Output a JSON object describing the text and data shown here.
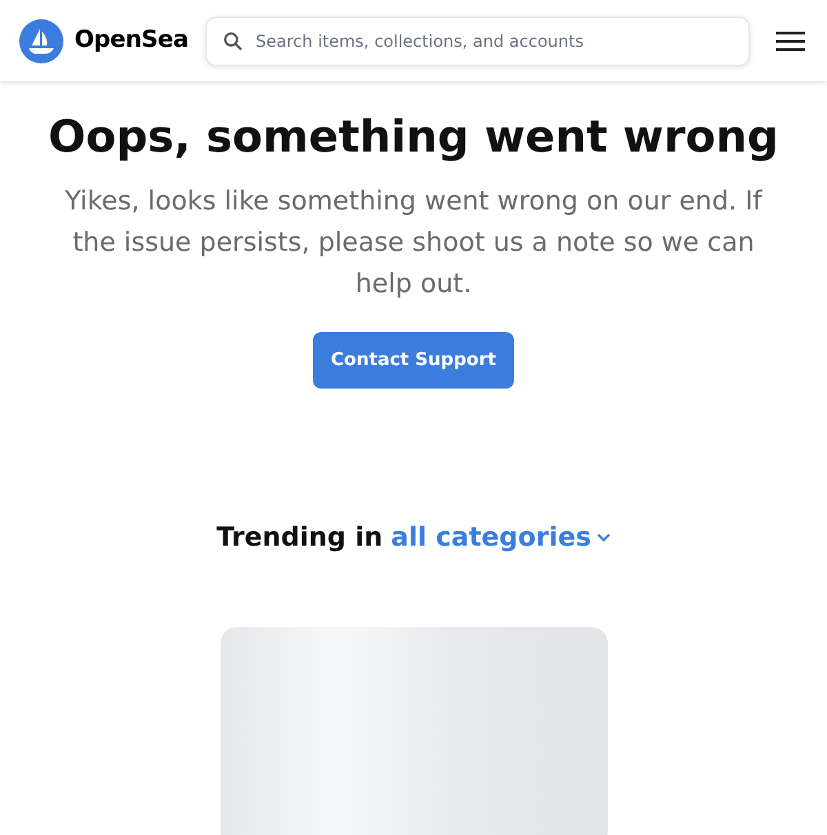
{
  "header": {
    "brand": "OpenSea",
    "search": {
      "placeholder": "Search items, collections, and accounts"
    }
  },
  "error": {
    "title": "Oops, something went wrong",
    "message": "Yikes, looks like something went wrong on our end. If the issue persists, please shoot us a note so we can help out.",
    "button": "Contact Support"
  },
  "trending": {
    "label": "Trending in",
    "category": "all categories"
  }
}
